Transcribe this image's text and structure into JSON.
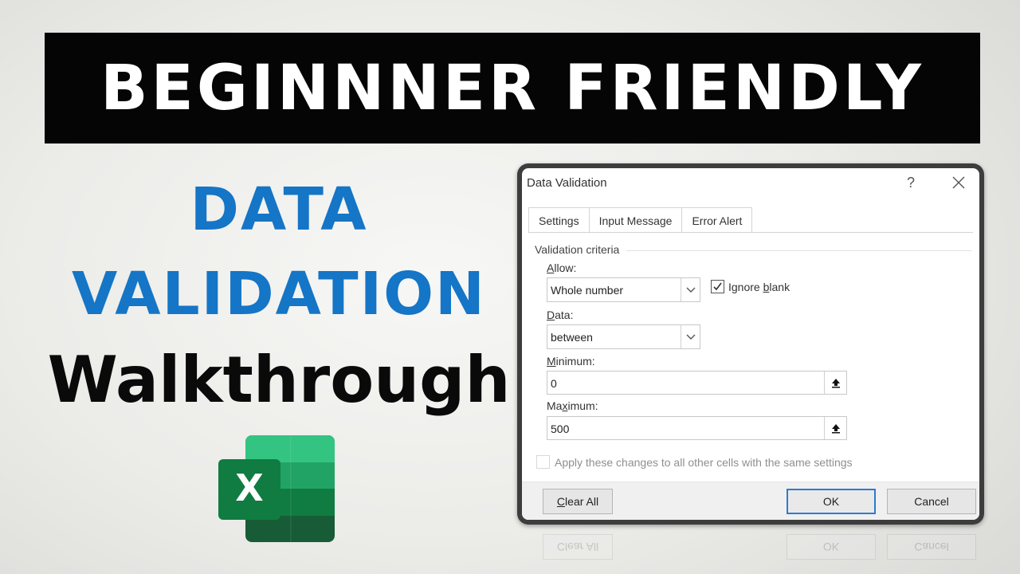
{
  "banner": {
    "text": "BEGINNNER FRIENDLY"
  },
  "titles": {
    "line1": "DATA",
    "line2": "VALIDATION",
    "line3": "Walkthrough"
  },
  "colors": {
    "accent_blue": "#1575c6",
    "excel_green": "#21a366",
    "excel_dark": "#107c41"
  },
  "logo": {
    "letter": "X",
    "icon": "excel-icon"
  },
  "dialog": {
    "title": "Data Validation",
    "help": "?",
    "tabs": [
      {
        "label": "Settings",
        "active": true
      },
      {
        "label": "Input Message",
        "active": false
      },
      {
        "label": "Error Alert",
        "active": false
      }
    ],
    "group_label": "Validation criteria",
    "allow": {
      "label_ul": "A",
      "label_rest": "llow:",
      "value": "Whole number"
    },
    "ignore_blank": {
      "label_pre": "Ignore ",
      "label_ul": "b",
      "label_post": "lank",
      "checked": true
    },
    "data": {
      "label_ul": "D",
      "label_rest": "ata:",
      "value": "between"
    },
    "minimum": {
      "label_ul": "M",
      "label_rest": "inimum:",
      "value": "0"
    },
    "maximum": {
      "label_pre": "Ma",
      "label_ul": "x",
      "label_rest": "imum:",
      "value": "500"
    },
    "apply_all": {
      "label": "Apply these changes to all other cells with the same settings",
      "checked": false
    },
    "buttons": {
      "clear_ul": "C",
      "clear_rest": "lear All",
      "ok": "OK",
      "cancel": "Cancel"
    }
  }
}
